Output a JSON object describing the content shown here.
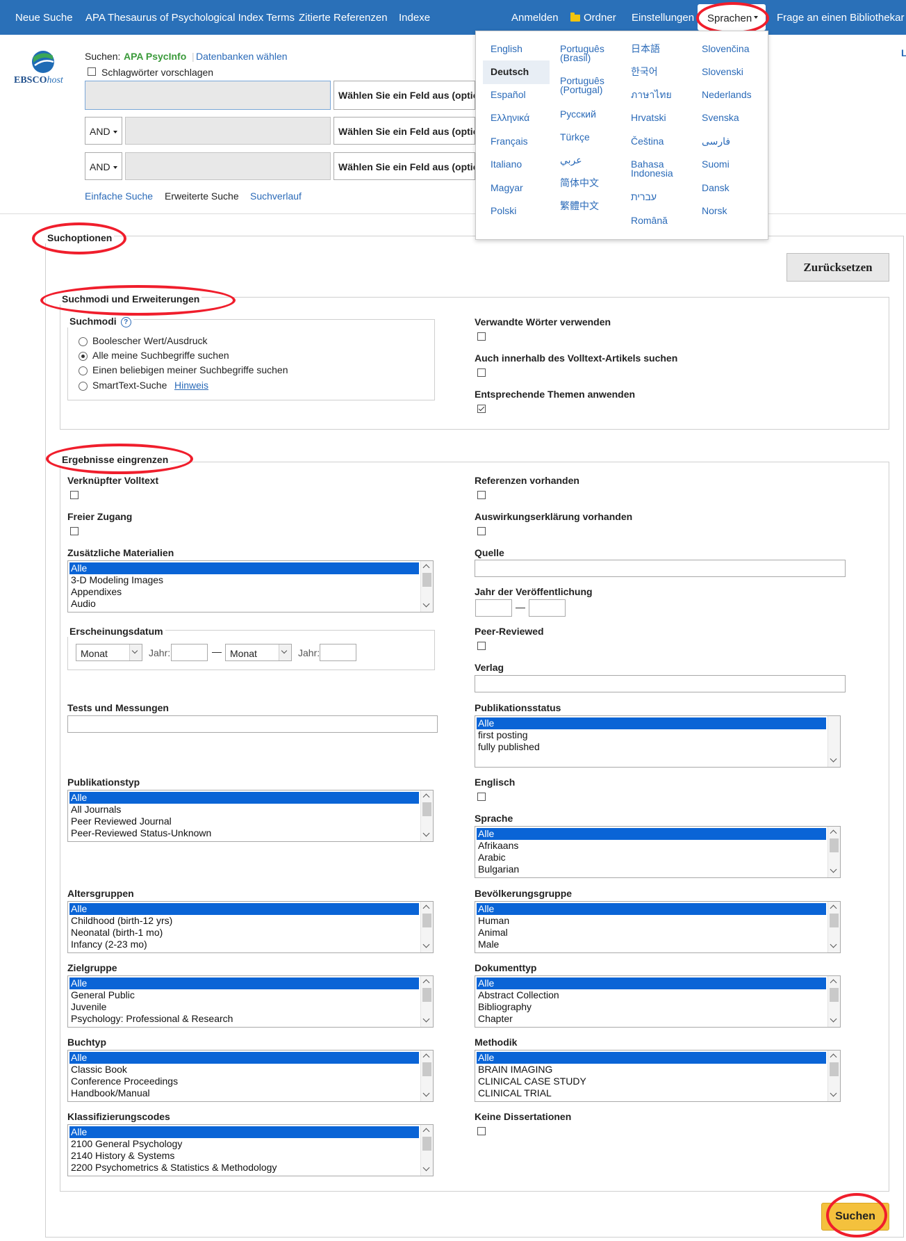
{
  "topnav": {
    "items": [
      "Neue Suche",
      "APA Thesaurus of Psychological Index Terms",
      "Zitierte Referenzen",
      "Indexe"
    ],
    "right": {
      "login": "Anmelden",
      "folder": "Ordner",
      "settings": "Einstellungen",
      "languages": "Sprachen",
      "librarian": "Frage an einen Bibliothekar"
    }
  },
  "languages": {
    "col1": [
      "English",
      "Deutsch",
      "Español",
      "Ελληνικά",
      "Français",
      "Italiano",
      "Magyar",
      "Polski"
    ],
    "col2": [
      "Português (Brasil)",
      "Português (Portugal)",
      "Русский",
      "Türkçe",
      "عربي",
      "简体中文",
      "繁體中文"
    ],
    "col3": [
      "日本語",
      "한국어",
      "ภาษาไทย",
      "Hrvatski",
      "Čeština",
      "Bahasa Indonesia",
      "עברית",
      "Română"
    ],
    "col4": [
      "Slovenčina",
      "Slovenski",
      "Nederlands",
      "Svenska",
      "فارسی",
      "Suomi",
      "Dansk",
      "Norsk"
    ],
    "selected": "Deutsch"
  },
  "logo": {
    "brand": "EBSCO",
    "suffix": "host"
  },
  "search": {
    "prefix": "Suchen:",
    "database": "APA PsycInfo",
    "choose_db": "Datenbanken wählen",
    "suggest": "Schlagwörter vorschlagen",
    "field_select": "Wählen Sie ein Feld aus (optional)",
    "op": "AND",
    "links": {
      "basic": "Einfache Suche",
      "advanced": "Erweiterte Suche",
      "history": "Suchverlauf"
    },
    "edge_letter": "L"
  },
  "options": {
    "title": "Suchoptionen",
    "reset": "Zurücksetzen",
    "modes_section": "Suchmodi und Erweiterungen",
    "modes_label": "Suchmodi",
    "modes": [
      "Boolescher Wert/Ausdruck",
      "Alle meine Suchbegriffe suchen",
      "Einen beliebigen meiner Suchbegriffe suchen",
      "SmartText-Suche"
    ],
    "hint": "Hinweis",
    "related_words": "Verwandte Wörter verwenden",
    "fulltext_search": "Auch innerhalb des Volltext-Artikels suchen",
    "equiv_subjects": "Entsprechende Themen anwenden",
    "limit_section": "Ergebnisse eingrenzen",
    "linked_fulltext": "Verknüpfter Volltext",
    "free_access": "Freier Zugang",
    "references": "Referenzen vorhanden",
    "impact": "Auswirkungserklärung vorhanden",
    "supplemental": {
      "label": "Zusätzliche Materialien",
      "items": [
        "Alle",
        "3-D Modeling Images",
        "Appendixes",
        "Audio"
      ]
    },
    "source": "Quelle",
    "pubyear": "Jahr der Veröffentlichung",
    "date": {
      "label": "Erscheinungsdatum",
      "month": "Monat",
      "year": "Jahr:",
      "dash": "—"
    },
    "peer": "Peer-Reviewed",
    "publisher": "Verlag",
    "tests": "Tests und Messungen",
    "pubstatus": {
      "label": "Publikationsstatus",
      "items": [
        "Alle",
        "first posting",
        "fully published"
      ]
    },
    "pubtype": {
      "label": "Publikationstyp",
      "items": [
        "Alle",
        "All Journals",
        "Peer Reviewed Journal",
        "Peer-Reviewed Status-Unknown"
      ]
    },
    "english": "Englisch",
    "language": {
      "label": "Sprache",
      "items": [
        "Alle",
        "Afrikaans",
        "Arabic",
        "Bulgarian"
      ]
    },
    "age": {
      "label": "Altersgruppen",
      "items": [
        "Alle",
        "Childhood (birth-12 yrs)",
        "Neonatal (birth-1 mo)",
        "Infancy (2-23 mo)"
      ]
    },
    "population": {
      "label": "Bevölkerungsgruppe",
      "items": [
        "Alle",
        "Human",
        "Animal",
        "Male"
      ]
    },
    "audience": {
      "label": "Zielgruppe",
      "items": [
        "Alle",
        "General Public",
        "Juvenile",
        "Psychology: Professional & Research"
      ]
    },
    "doctype": {
      "label": "Dokumenttyp",
      "items": [
        "Alle",
        "Abstract Collection",
        "Bibliography",
        "Chapter"
      ]
    },
    "booktype": {
      "label": "Buchtyp",
      "items": [
        "Alle",
        "Classic Book",
        "Conference Proceedings",
        "Handbook/Manual"
      ]
    },
    "method": {
      "label": "Methodik",
      "items": [
        "Alle",
        "BRAIN IMAGING",
        "CLINICAL CASE STUDY",
        "CLINICAL TRIAL"
      ]
    },
    "classcodes": {
      "label": "Klassifizierungscodes",
      "items": [
        "Alle",
        "2100 General Psychology",
        "2140 History & Systems",
        "2200 Psychometrics & Statistics & Methodology"
      ]
    },
    "no_diss": "Keine Dissertationen",
    "search_btn": "Suchen"
  },
  "colors": {
    "nav": "#2a70b8",
    "link": "#2a6ab8",
    "highlight": "#f01e2c",
    "select": "#0a64d6",
    "search_btn": "#f4c13d"
  }
}
